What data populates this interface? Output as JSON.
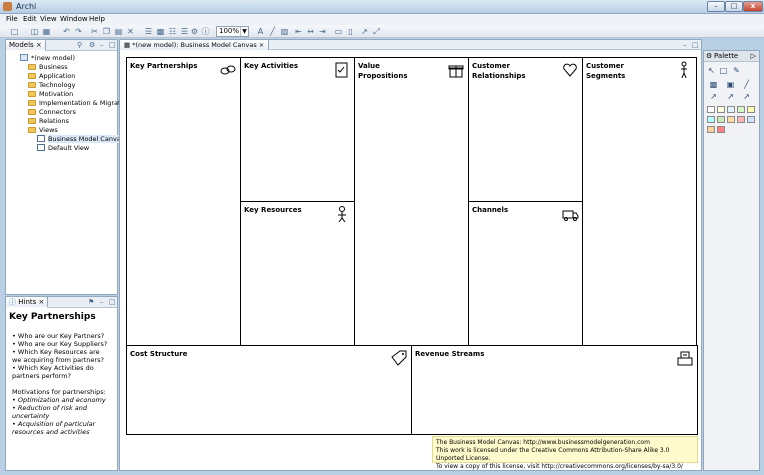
{
  "window": {
    "title": "Archi"
  },
  "menu": [
    "File",
    "Edit",
    "View",
    "Window",
    "Help"
  ],
  "toolbar": {
    "zoom": "100%"
  },
  "models_panel": {
    "tab": "Models",
    "tree": [
      {
        "label": "*(new model)",
        "icon": "model"
      },
      {
        "label": "Business",
        "icon": "folder"
      },
      {
        "label": "Application",
        "icon": "folder"
      },
      {
        "label": "Technology",
        "icon": "folder"
      },
      {
        "label": "Motivation",
        "icon": "folder"
      },
      {
        "label": "Implementation & Migration",
        "icon": "folder"
      },
      {
        "label": "Connectors",
        "icon": "folder"
      },
      {
        "label": "Relations",
        "icon": "folder"
      },
      {
        "label": "Views",
        "icon": "folder"
      },
      {
        "label": "Business Model Canvas",
        "icon": "view",
        "selected": true
      },
      {
        "label": "Default View",
        "icon": "view"
      }
    ]
  },
  "hints_panel": {
    "tab": "Hints",
    "title": "Key Partnerships",
    "lines": [
      "•  Who are our Key Partners?",
      "•  Who are our Key Suppliers?",
      "•  Which Key Resources are",
      "we acquiring from partners?",
      "•  Which Key Activities do",
      "partners perform?",
      "",
      "Motivations for partnerships:",
      "•  Optimization and economy",
      "•  Reduction of risk and",
      "uncertainty",
      "•  Acquisition of particular",
      "resources and activities"
    ],
    "italic_lines": [
      8,
      9,
      10,
      11,
      12
    ]
  },
  "editor": {
    "tab": "*(new model): Business Model Canvas",
    "cells": {
      "key_partnerships": "Key Partnerships",
      "key_activities": "Key Activities",
      "value_propositions_1": "Value",
      "value_propositions_2": "Propositions",
      "customer_relationships_1": "Customer",
      "customer_relationships_2": "Relationships",
      "customer_segments_1": "Customer",
      "customer_segments_2": "Segments",
      "key_resources": "Key Resources",
      "channels": "Channels",
      "cost_structure": "Cost Structure",
      "revenue_streams": "Revenue Streams"
    },
    "license": [
      "The Business Model Canvas: http://www.businessmodelgeneration.com",
      "This work is licensed under the Creative Commons Attribution-Share Alike 3.0 Unported License.",
      "To view a copy of this license, visit http://creativecommons.org/licenses/by-sa/3.0/"
    ]
  },
  "palette": {
    "title": "Palette",
    "swatch_colors": [
      "#ffffff",
      "#fffde0",
      "#e0f3ff",
      "#d8f5c8",
      "#ffffb5",
      "#b5fffc",
      "#c9e7b7",
      "#ffe0a0",
      "#ffb5b5",
      "#cfe3ff",
      "#ffd0a0",
      "#ff8080"
    ]
  }
}
